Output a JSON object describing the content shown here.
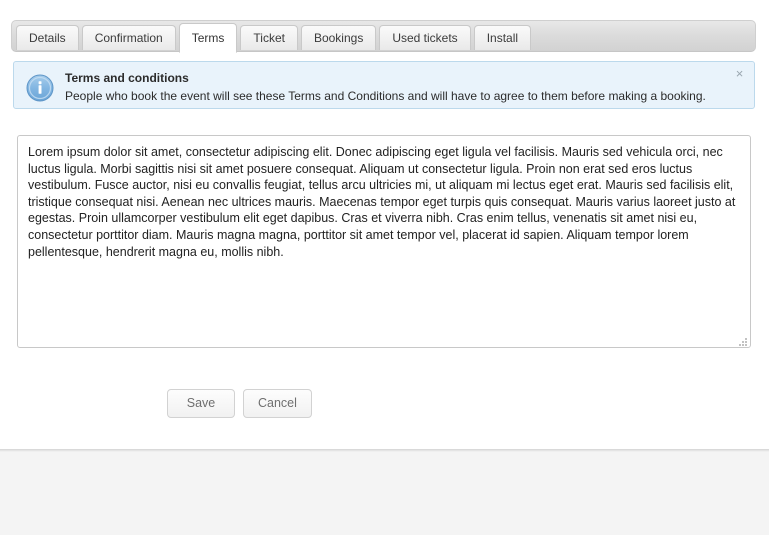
{
  "tabs": [
    {
      "label": "Details",
      "active": false
    },
    {
      "label": "Confirmation",
      "active": false
    },
    {
      "label": "Terms",
      "active": true
    },
    {
      "label": "Ticket",
      "active": false
    },
    {
      "label": "Bookings",
      "active": false
    },
    {
      "label": "Used tickets",
      "active": false
    },
    {
      "label": "Install",
      "active": false
    }
  ],
  "notice": {
    "icon": "info-circle-icon",
    "title": "Terms and conditions",
    "text": "People who book the event will see these Terms and Conditions and will have to agree to them before making a booking.",
    "close_label": "×",
    "background_color": "#e9f3fb",
    "border_color": "#bcd9ec",
    "icon_color": "#6aa9dd"
  },
  "terms_editor": {
    "name": "terms-textarea",
    "placeholder": "Enter your terms and conditions",
    "value": "Lorem ipsum dolor sit amet, consectetur adipiscing elit. Donec adipiscing eget ligula vel facilisis. Mauris sed vehicula orci, nec luctus ligula. Morbi sagittis nisi sit amet posuere consequat. Aliquam ut consectetur ligula. Proin non erat sed eros luctus vestibulum. Fusce auctor, nisi eu convallis feugiat, tellus arcu ultricies mi, ut aliquam mi lectus eget erat. Mauris sed facilisis elit, tristique consequat nisi. Aenean nec ultrices mauris. Maecenas tempor eget turpis quis consequat. Mauris varius laoreet justo at egestas. Proin ullamcorper vestibulum elit eget dapibus. Cras et viverra nibh. Cras enim tellus, venenatis sit amet nisi eu, consectetur porttitor diam. Mauris magna magna, porttitor sit amet tempor vel, placerat id sapien. Aliquam tempor lorem pellentesque, hendrerit magna eu, mollis nibh."
  },
  "actions": {
    "save_label": "Save",
    "cancel_label": "Cancel"
  }
}
